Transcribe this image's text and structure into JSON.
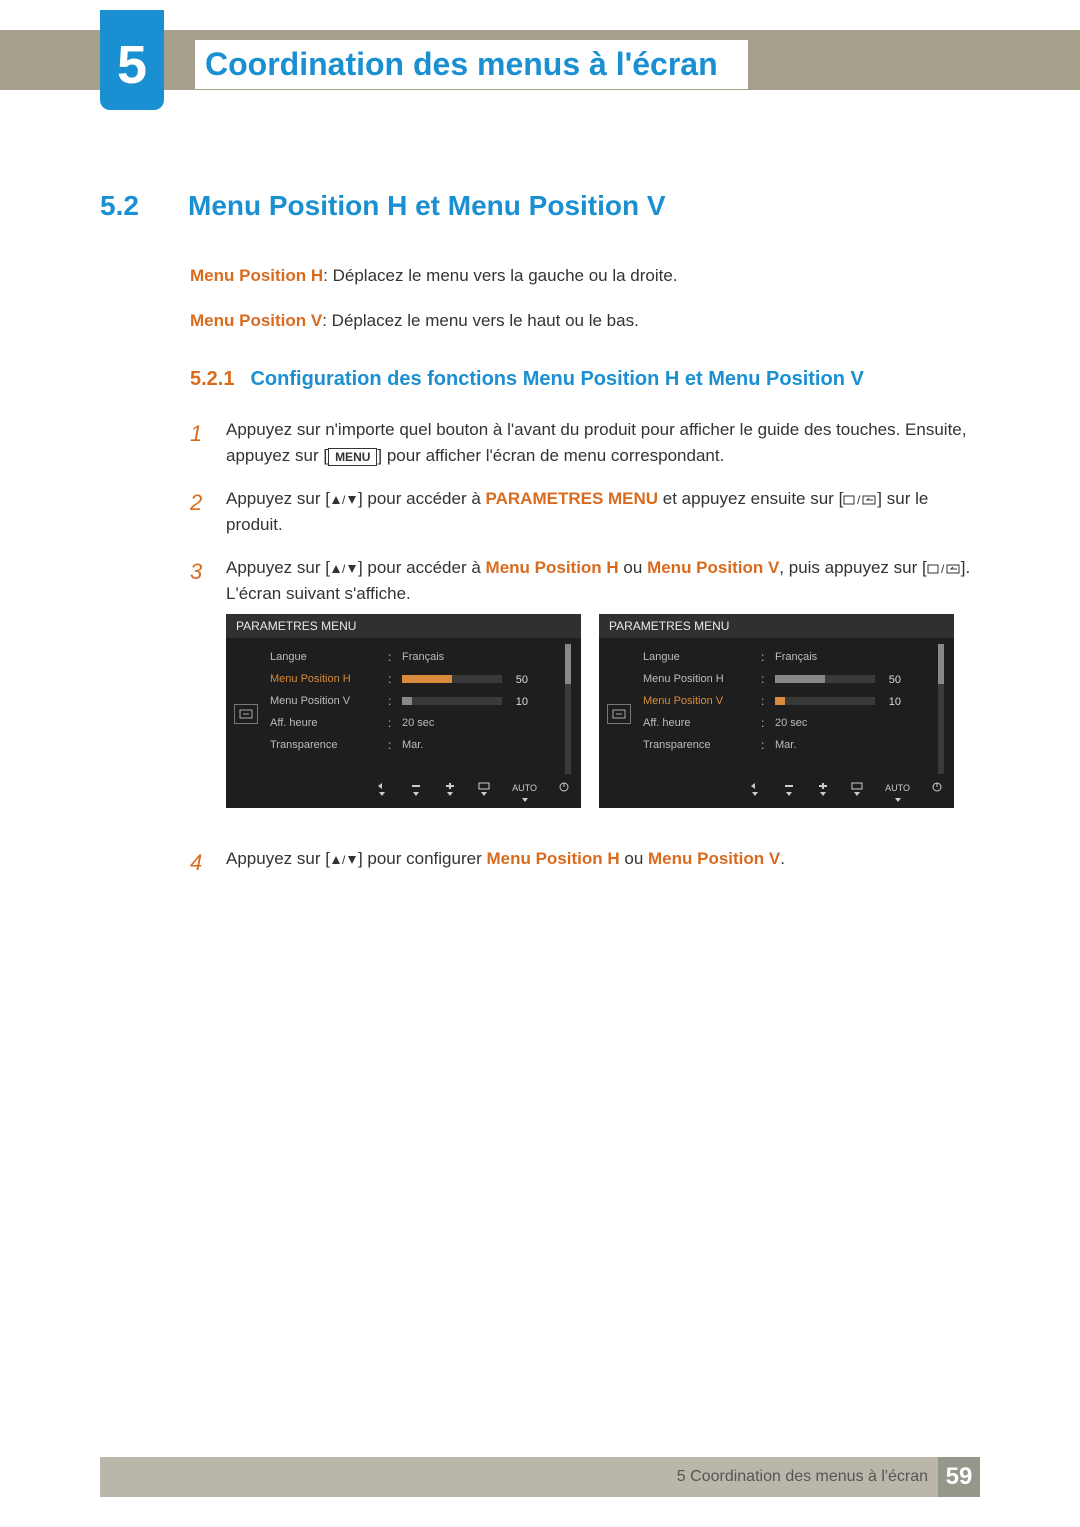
{
  "chapter": {
    "number": "5",
    "title": "Coordination des menus à l'écran"
  },
  "section": {
    "number": "5.2",
    "title": "Menu Position H et Menu Position V"
  },
  "intro": {
    "h_label": "Menu Position H",
    "h_text": ": Déplacez le menu vers la gauche ou la droite.",
    "v_label": "Menu Position V",
    "v_text": ": Déplacez le menu vers le haut ou le bas."
  },
  "subsection": {
    "number": "5.2.1",
    "title": "Configuration des fonctions Menu Position H et Menu Position V"
  },
  "steps": {
    "s1": {
      "num": "1",
      "a": "Appuyez sur n'importe quel bouton à l'avant du produit pour afficher le guide des touches. Ensuite, appuyez sur [",
      "menu": "MENU",
      "b": "] pour afficher l'écran de menu correspondant."
    },
    "s2": {
      "num": "2",
      "a": "Appuyez sur [",
      "b": "] pour accéder à ",
      "target": "PARAMETRES MENU",
      "c": " et appuyez ensuite sur [",
      "d": "] sur le produit."
    },
    "s3": {
      "num": "3",
      "a": "Appuyez sur [",
      "b": "] pour accéder à ",
      "t1": "Menu Position H",
      "mid": " ou ",
      "t2": "Menu Position V",
      "c": ", puis appuyez sur [",
      "d": "]. L'écran suivant s'affiche."
    },
    "s4": {
      "num": "4",
      "a": "Appuyez sur [",
      "b": "] pour configurer ",
      "t1": "Menu Position H",
      "mid": " ou ",
      "t2": "Menu Position V",
      "c": "."
    }
  },
  "osd": {
    "title": "PARAMETRES MENU",
    "rows": {
      "langue": {
        "label": "Langue",
        "value": "Français"
      },
      "posH": {
        "label": "Menu Position H",
        "value": "50",
        "percent": 50
      },
      "posV": {
        "label": "Menu Position V",
        "value": "10",
        "percent": 10
      },
      "aff": {
        "label": "Aff. heure",
        "value": "20 sec"
      },
      "trans": {
        "label": "Transparence",
        "value": "Mar."
      }
    },
    "footer": {
      "auto": "AUTO"
    }
  },
  "footer": {
    "text": "5 Coordination des menus à l'écran",
    "page": "59"
  }
}
